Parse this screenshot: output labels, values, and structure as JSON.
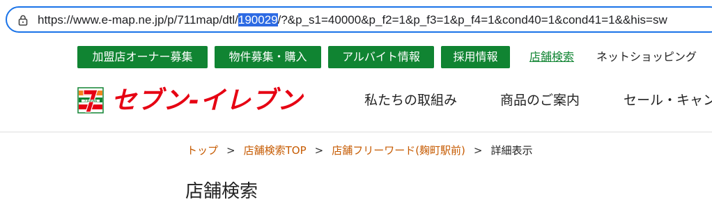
{
  "browser": {
    "url_prefix": "https://www.e-map.ne.jp/p/711map/dtl/",
    "url_selected": "190029",
    "url_suffix": "/?&p_s1=40000&p_f2=1&p_f3=1&p_f4=1&cond40=1&cond41=1&&his=sw",
    "selection_color": "#2d6ae3"
  },
  "topnav": {
    "buttons": [
      {
        "label": "加盟店オーナー募集"
      },
      {
        "label": "物件募集・購入"
      },
      {
        "label": "アルバイト情報"
      },
      {
        "label": "採用情報"
      }
    ],
    "store_search": "店舗検索",
    "net_shopping": "ネットショッピング",
    "accent_color": "#108432"
  },
  "logo": {
    "text": "セブン-イレブン",
    "mark_label": "7 ELEVEN",
    "brand_red": "#e60012",
    "brand_orange": "#f58220",
    "brand_green": "#108432"
  },
  "mainnav": {
    "items": [
      {
        "label": "私たちの取組み"
      },
      {
        "label": "商品のご案内"
      },
      {
        "label": "セール・キャンペーン"
      }
    ]
  },
  "breadcrumb": {
    "items": [
      {
        "label": "トップ"
      },
      {
        "label": "店舗検索TOP"
      },
      {
        "label": "店舗フリーワード(麹町駅前)"
      }
    ],
    "separator": ">",
    "current": "詳細表示",
    "link_color": "#c65a00"
  },
  "page": {
    "title": "店舗検索"
  }
}
